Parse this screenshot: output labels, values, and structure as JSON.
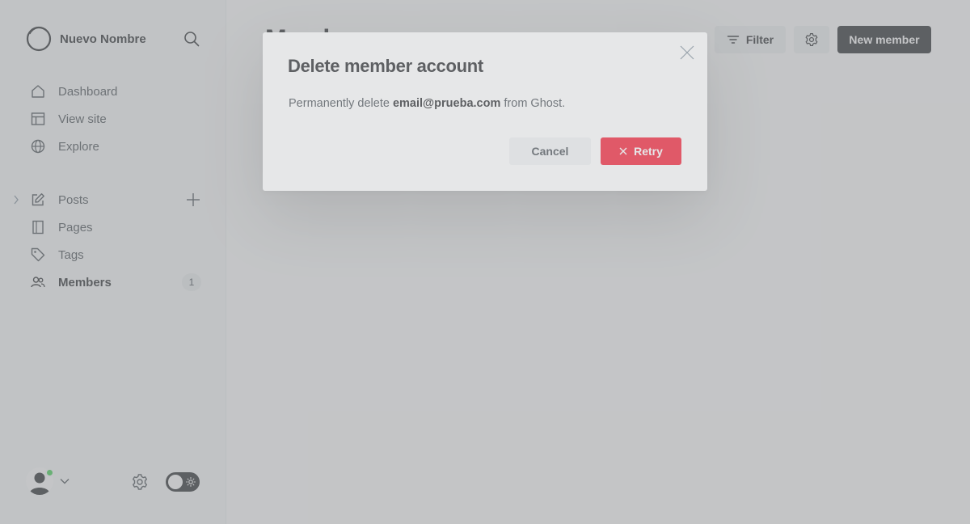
{
  "sidebar": {
    "site_name": "Nuevo Nombre",
    "top_items": [
      {
        "label": "Dashboard",
        "icon": "home-icon"
      },
      {
        "label": "View site",
        "icon": "layout-icon"
      },
      {
        "label": "Explore",
        "icon": "globe-icon"
      }
    ],
    "main_items": [
      {
        "label": "Posts",
        "icon": "pen-icon"
      },
      {
        "label": "Pages",
        "icon": "page-icon"
      },
      {
        "label": "Tags",
        "icon": "tag-icon"
      },
      {
        "label": "Members",
        "icon": "members-icon",
        "count": "1",
        "active": true
      }
    ]
  },
  "header": {
    "title": "Members",
    "filter_label": "Filter",
    "new_member_label": "New member"
  },
  "modal": {
    "title": "Delete member account",
    "body_prefix": "Permanently delete ",
    "body_email": "email@prueba.com",
    "body_suffix": " from Ghost.",
    "cancel_label": "Cancel",
    "retry_label": "Retry"
  },
  "colors": {
    "accent_dark": "#15171a",
    "danger": "#f50b23",
    "online": "#30cf43"
  }
}
